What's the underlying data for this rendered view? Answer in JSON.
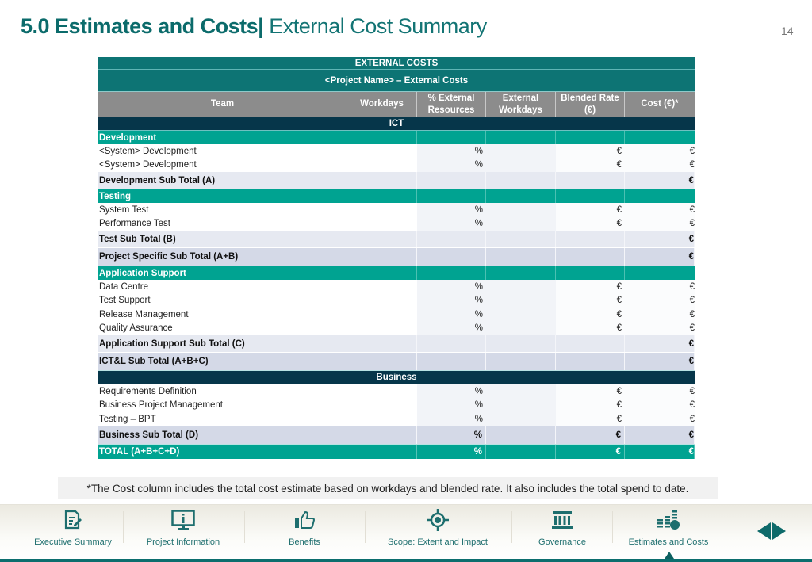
{
  "header": {
    "section": "5.0 Estimates and Costs",
    "divider": "|",
    "subtitle": "External Cost Summary",
    "page_number": "14"
  },
  "table": {
    "title": "EXTERNAL COSTS",
    "project_title": "<Project Name> – External Costs",
    "columns": [
      "Team",
      "Workdays",
      "% External Resources",
      "External Workdays",
      "Blended Rate (€)",
      "Cost (€)*"
    ],
    "columns_split": {
      "pct_line1": "% External",
      "pct_line2": "Resources",
      "ew_line1": "External",
      "ew_line2": "Workdays",
      "br_line1": "Blended Rate",
      "br_line2": "(€)"
    },
    "ict_band": "ICT",
    "business_band": "Business",
    "sections": {
      "development": {
        "label": "Development",
        "items": [
          {
            "team": "<System> Development",
            "pct": "%",
            "rate": "€",
            "cost": "€"
          },
          {
            "team": "<System> Development",
            "pct": "%",
            "rate": "€",
            "cost": "€"
          }
        ],
        "subtotal": {
          "label": "Development Sub Total (A)",
          "cost": "€"
        }
      },
      "testing": {
        "label": "Testing",
        "items": [
          {
            "team": "System Test",
            "pct": "%",
            "rate": "€",
            "cost": "€"
          },
          {
            "team": "Performance Test",
            "pct": "%",
            "rate": "€",
            "cost": "€"
          }
        ],
        "subtotal": {
          "label": "Test Sub Total (B)",
          "cost": "€"
        }
      },
      "project_specific_subtotal": {
        "label": "Project Specific Sub Total (A+B)",
        "cost": "€"
      },
      "application_support": {
        "label": "Application Support",
        "items": [
          {
            "team": "Data Centre",
            "pct": "%",
            "rate": "€",
            "cost": "€"
          },
          {
            "team": "Test Support",
            "pct": "%",
            "rate": "€",
            "cost": "€"
          },
          {
            "team": "Release Management",
            "pct": "%",
            "rate": "€",
            "cost": "€"
          },
          {
            "team": "Quality Assurance",
            "pct": "%",
            "rate": "€",
            "cost": "€"
          }
        ],
        "subtotal": {
          "label": "Application Support Sub Total (C)",
          "cost": "€"
        }
      },
      "ictl_subtotal": {
        "label": "ICT&L Sub Total (A+B+C)",
        "cost": "€"
      },
      "business": {
        "items": [
          {
            "team": "Requirements Definition",
            "pct": "%",
            "rate": "€",
            "cost": "€"
          },
          {
            "team": "Business Project Management",
            "pct": "%",
            "rate": "€",
            "cost": "€"
          },
          {
            "team": "Testing – BPT",
            "pct": "%",
            "rate": "€",
            "cost": "€"
          }
        ],
        "subtotal": {
          "label": "Business Sub Total (D)",
          "pct": "%",
          "rate": "€",
          "cost": "€"
        }
      },
      "total": {
        "label": "TOTAL (A+B+C+D)",
        "pct": "%",
        "rate": "€",
        "cost": "€"
      }
    }
  },
  "footnote": "*The Cost column includes the total cost estimate based on workdays and blended rate. It also includes the total spend to date.",
  "footer_nav": {
    "items": [
      {
        "label": "Executive Summary",
        "icon": "document-edit-icon"
      },
      {
        "label": "Project Information",
        "icon": "monitor-info-icon"
      },
      {
        "label": "Benefits",
        "icon": "thumbs-up-icon"
      },
      {
        "label": "Scope: Extent and Impact",
        "icon": "target-icon"
      },
      {
        "label": "Governance",
        "icon": "institution-icon"
      },
      {
        "label": "Estimates and Costs",
        "icon": "coins-stack-icon"
      }
    ],
    "active": "Estimates and Costs"
  },
  "colors": {
    "brand_teal": "#0d7474",
    "section_green": "#00a391",
    "band_navy": "#06364a",
    "header_gray": "#8c8c8c"
  }
}
